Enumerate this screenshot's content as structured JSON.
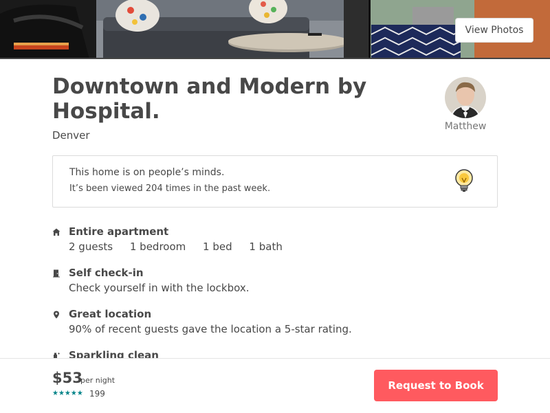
{
  "hero": {
    "view_photos_label": "View Photos"
  },
  "listing": {
    "title": "Downtown and Modern by Hospital.",
    "city": "Denver"
  },
  "host": {
    "name": "Matthew"
  },
  "notice": {
    "title": "This home is on people’s minds.",
    "body": "It’s been viewed 204 times in the past week.",
    "icon": "lightbulb-icon"
  },
  "features": [
    {
      "icon": "home-icon",
      "heading": "Entire apartment",
      "details": [
        "2 guests",
        "1 bedroom",
        "1 bed",
        "1 bath"
      ]
    },
    {
      "icon": "door-icon",
      "heading": "Self check-in",
      "details": [
        "Check yourself in with the lockbox."
      ]
    },
    {
      "icon": "location-pin-icon",
      "heading": "Great location",
      "details": [
        "90% of recent guests gave the location a 5-star rating."
      ]
    },
    {
      "icon": "sparkle-clean-icon",
      "heading": "Sparkling clean",
      "details": []
    }
  ],
  "booking": {
    "price": "$53",
    "per_night": "per night",
    "stars": "★★★★★",
    "rating": 5,
    "review_count": "199",
    "button_label": "Request to Book"
  },
  "colors": {
    "accent": "#ff5a5f",
    "teal": "#008489",
    "text": "#484848",
    "muted": "#767676",
    "border": "#dbdbdb"
  }
}
